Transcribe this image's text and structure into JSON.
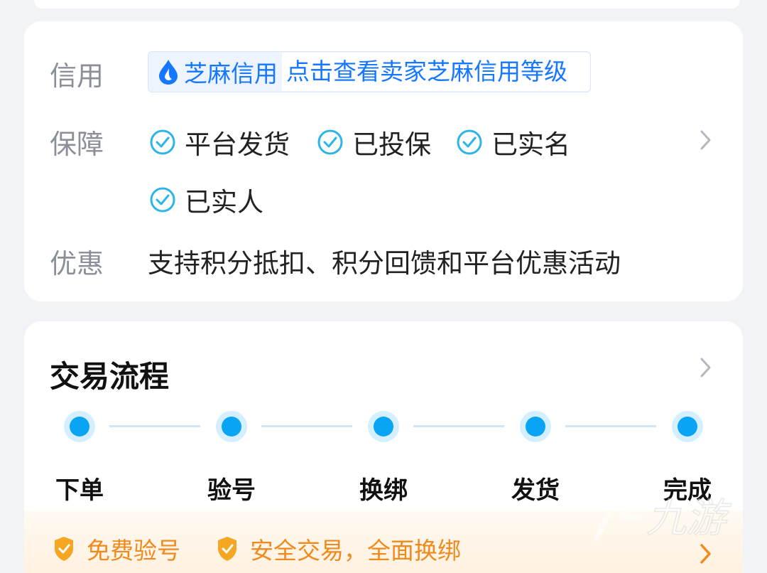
{
  "info": {
    "credit": {
      "label": "信用",
      "brand": "芝麻信用",
      "link_text": "点击查看卖家芝麻信用等级"
    },
    "guarantee": {
      "label": "保障",
      "items": [
        "平台发货",
        "已投保",
        "已实名",
        "已实人"
      ]
    },
    "discount": {
      "label": "优惠",
      "text": "支持积分抵扣、积分回馈和平台优惠活动"
    }
  },
  "flow": {
    "title": "交易流程",
    "steps": [
      "下单",
      "验号",
      "换绑",
      "发货",
      "完成"
    ]
  },
  "promo": {
    "items": [
      "免费验号",
      "安全交易，全面换绑"
    ]
  },
  "watermark": {
    "text": "九游"
  },
  "colors": {
    "accent_blue": "#1677ff",
    "step_blue": "#0aa4f5",
    "check_blue": "#2bb5e8",
    "promo_orange": "#f08a1c"
  },
  "icons": [
    "sesame-credit-icon",
    "check-circle-icon",
    "chevron-right-icon",
    "shield-check-icon"
  ]
}
